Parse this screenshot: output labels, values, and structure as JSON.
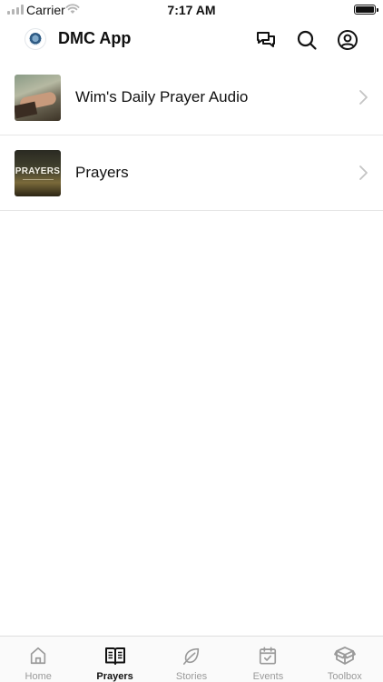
{
  "status_bar": {
    "carrier": "Carrier",
    "time": "7:17 AM"
  },
  "header": {
    "title": "DMC App",
    "icons": [
      "chat-bubbles-icon",
      "search-icon",
      "account-icon"
    ]
  },
  "list": {
    "items": [
      {
        "title": "Wim's Daily Prayer Audio",
        "thumbnail": "praying-hands"
      },
      {
        "title": "Prayers",
        "thumbnail": "prayers-cover",
        "thumbnail_text": "PRAYERS"
      }
    ]
  },
  "tab_bar": {
    "active": "Prayers",
    "tabs": [
      {
        "label": "Home",
        "icon": "home-icon"
      },
      {
        "label": "Prayers",
        "icon": "book-icon"
      },
      {
        "label": "Stories",
        "icon": "leaf-icon"
      },
      {
        "label": "Events",
        "icon": "calendar-check-icon"
      },
      {
        "label": "Toolbox",
        "icon": "box-icon"
      }
    ]
  },
  "colors": {
    "text": "#111111",
    "inactive_tab": "#9a9a9a",
    "divider": "#e6e6e6",
    "chevron": "#c4c4c4"
  }
}
